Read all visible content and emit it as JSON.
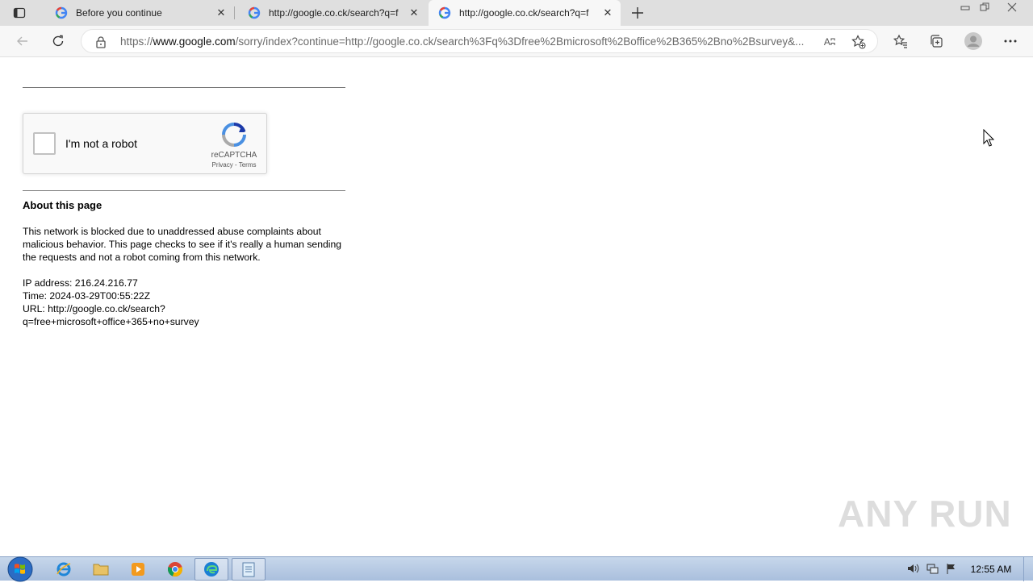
{
  "browser": {
    "tabs": [
      {
        "title": "Before you continue",
        "active": false
      },
      {
        "title": "http://google.co.ck/search?q=f",
        "active": false
      },
      {
        "title": "http://google.co.ck/search?q=f",
        "active": true
      }
    ],
    "address": {
      "scheme": "https://",
      "host": "www.google.com",
      "rest": "/sorry/index?continue=http://google.co.ck/search%3Fq%3Dfree%2Bmicrosoft%2Boffice%2B365%2Bno%2Bsurvey&..."
    },
    "read_aloud_label": "Aʭ"
  },
  "captcha": {
    "label": "I'm not a robot",
    "brand": "reCAPTCHA",
    "links": "Privacy - Terms"
  },
  "about": {
    "title": "About this page",
    "text": "This network is blocked due to unaddressed abuse complaints about malicious behavior. This page checks to see if it's really a human sending the requests and not a robot coming from this network.",
    "ip_line": "IP address: 216.24.216.77",
    "time_line": "Time: 2024-03-29T00:55:22Z",
    "url_line1": "URL: http://google.co.ck/search?",
    "url_line2": "q=free+microsoft+office+365+no+survey"
  },
  "watermark": "ANY RUN",
  "taskbar": {
    "clock": "12:55 AM"
  }
}
